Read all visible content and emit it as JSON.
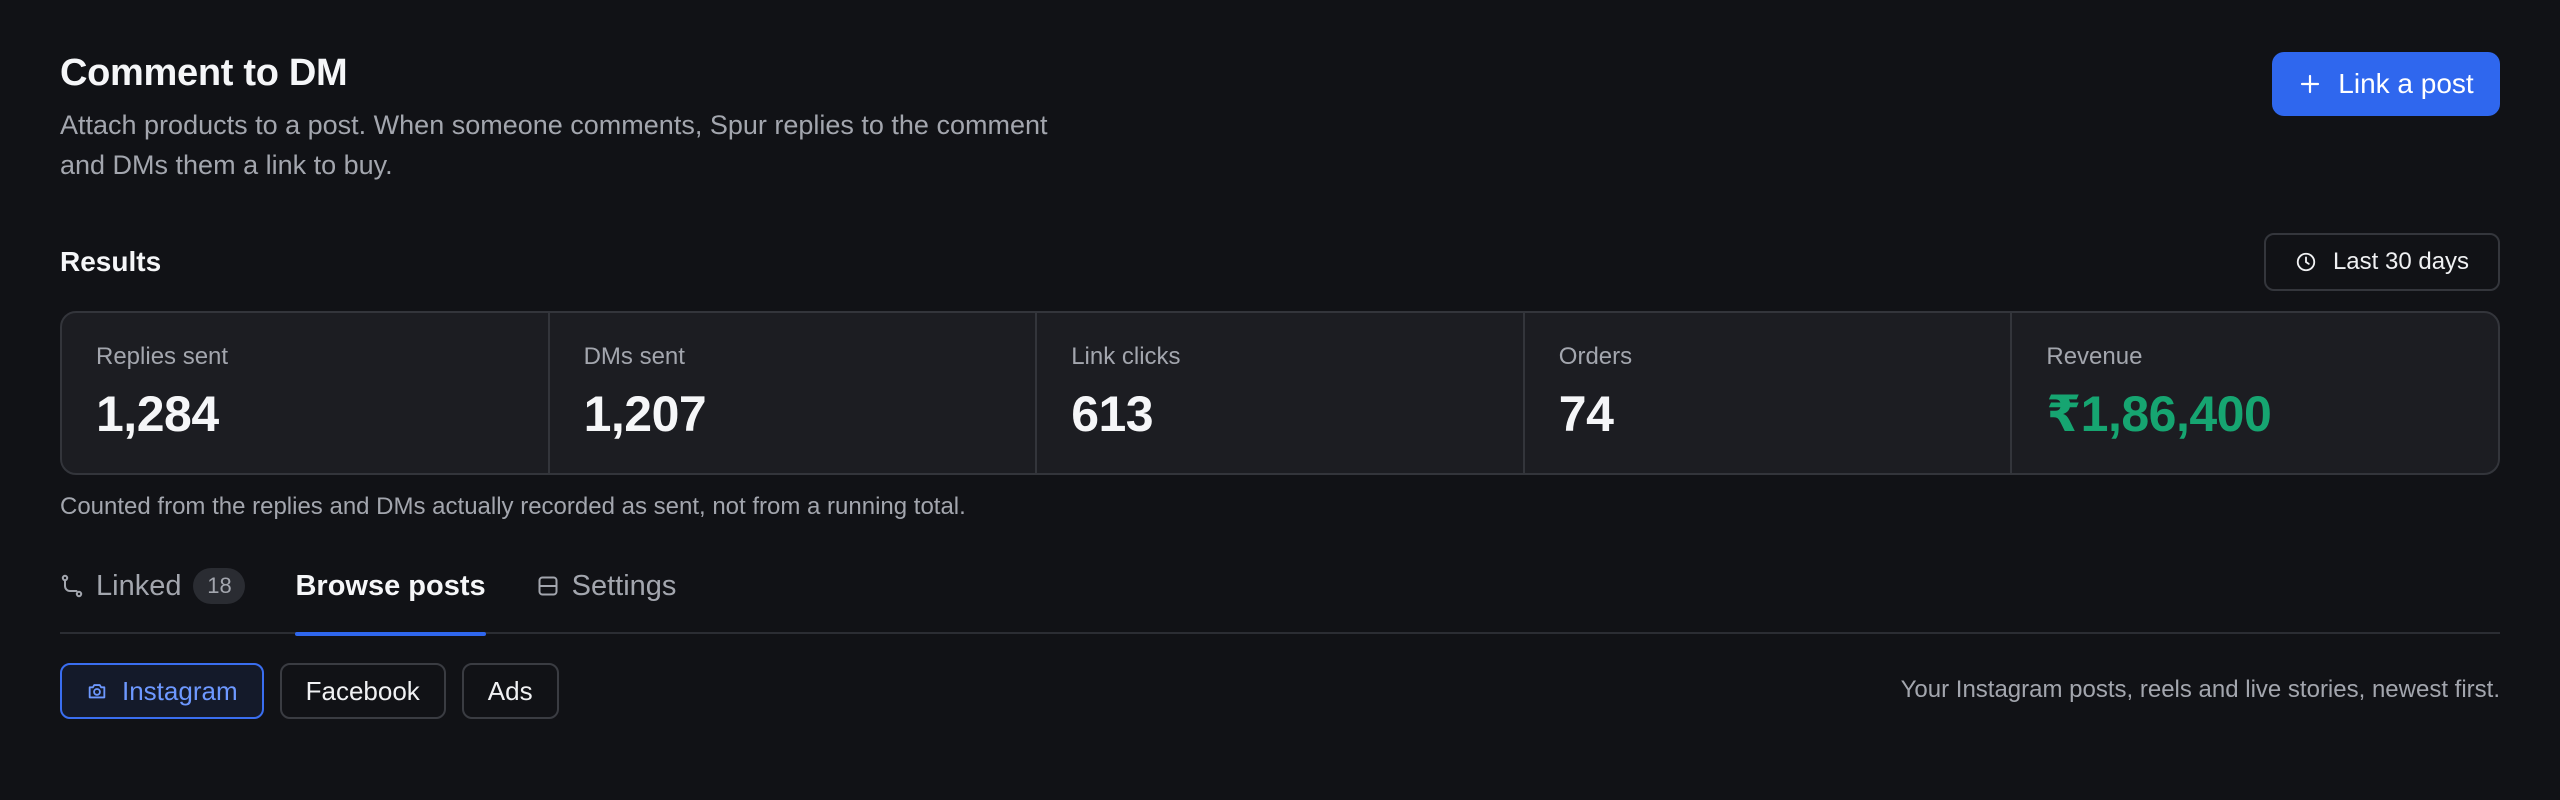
{
  "header": {
    "title": "Comment to DM",
    "subtitle": "Attach products to a post. When someone comments, Spur replies to the comment and DMs them a link to buy.",
    "primary_action": "Link a post"
  },
  "results": {
    "label": "Results",
    "date_range": "Last 30 days",
    "stats": [
      {
        "label": "Replies sent",
        "value": "1,284"
      },
      {
        "label": "DMs sent",
        "value": "1,207"
      },
      {
        "label": "Link clicks",
        "value": "613"
      },
      {
        "label": "Orders",
        "value": "74"
      },
      {
        "label": "Revenue",
        "value": "₹1,86,400"
      }
    ],
    "footnote": "Counted from the replies and DMs actually recorded as sent, not from a running total."
  },
  "tabs": [
    {
      "label": "Linked",
      "badge": "18",
      "icon": "flow-icon"
    },
    {
      "label": "Browse posts",
      "active": true
    },
    {
      "label": "Settings",
      "icon": "settings-panel-icon"
    }
  ],
  "filters": {
    "chips": [
      {
        "label": "Instagram",
        "icon": "camera-icon",
        "active": true
      },
      {
        "label": "Facebook"
      },
      {
        "label": "Ads"
      }
    ],
    "hint": "Your Instagram posts, reels and live stories, newest first."
  },
  "colors": {
    "background": "#111216",
    "accent": "#2f67ee",
    "revenue": "#16a571"
  }
}
